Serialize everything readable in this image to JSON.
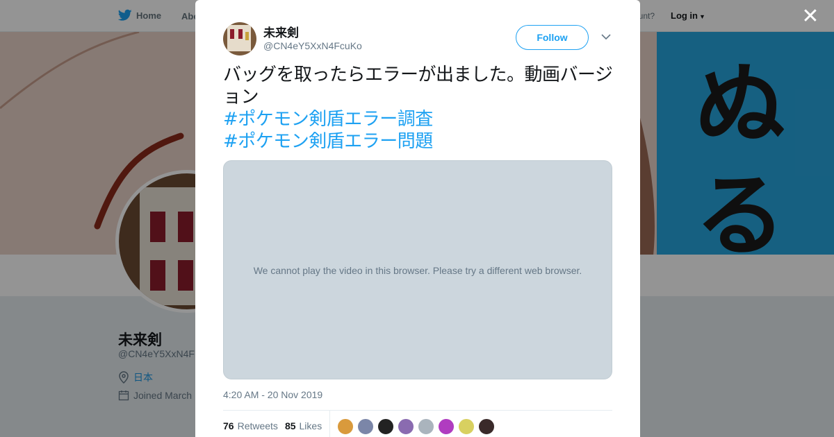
{
  "topbar": {
    "home_label": "Home",
    "about_label": "Abo",
    "account_prompt": "ccount?",
    "login_label": "Log in"
  },
  "banner": {
    "glyph1": "ぬ",
    "glyph2": "る"
  },
  "profile": {
    "name": "未来剣",
    "handle": "@CN4eY5XxN4F",
    "location": "日本",
    "joined": "Joined March"
  },
  "tweet": {
    "author_name": "未来剣",
    "author_handle": "@CN4eY5XxN4FcuKo",
    "follow_label": "Follow",
    "text": "バッグを取ったらエラーが出ました。動画バージョン",
    "hashtags": [
      "#ポケモン剣盾エラー調査",
      "#ポケモン剣盾エラー問題"
    ],
    "video_message": "We cannot play the video in this browser. Please try a different web browser.",
    "timestamp": "4:20 AM - 20 Nov 2019",
    "retweets_count": "76",
    "retweets_label": "Retweets",
    "likes_count": "85",
    "likes_label": "Likes"
  },
  "likers": [
    {
      "color": "#d99a3c"
    },
    {
      "color": "#7b86a8"
    },
    {
      "color": "#222222"
    },
    {
      "color": "#8a6bb0"
    },
    {
      "color": "#aab4bd"
    },
    {
      "color": "#b03cc0"
    },
    {
      "color": "#d8d060"
    },
    {
      "color": "#3a2a2a"
    }
  ],
  "colors": {
    "accent": "#1da1f2",
    "secondary_text": "#657786",
    "video_bg": "#ccd6dd"
  }
}
